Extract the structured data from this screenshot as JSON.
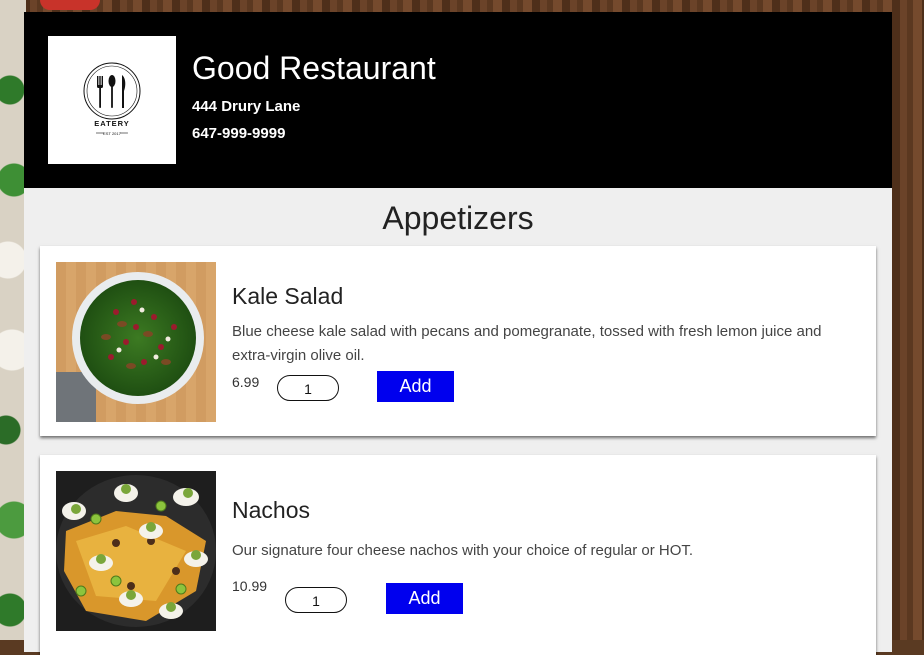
{
  "restaurant": {
    "name": "Good Restaurant",
    "address": "444 Drury Lane",
    "phone": "647-999-9999",
    "logo_text": "EATERY",
    "logo_subtext": "EST 2017"
  },
  "section": {
    "title": "Appetizers"
  },
  "items": [
    {
      "name": "Kale Salad",
      "description": "Blue cheese kale salad with pecans and pomegranate, tossed with fresh lemon juice and extra-virgin olive oil.",
      "price": "6.99",
      "quantity": "1",
      "add_label": "Add",
      "image_icon": "kale-salad-photo"
    },
    {
      "name": "Nachos",
      "description": "Our signature four cheese nachos with your choice of regular or HOT.",
      "price": "10.99",
      "quantity": "1",
      "add_label": "Add",
      "image_icon": "nachos-photo"
    }
  ],
  "colors": {
    "header_bg": "#000000",
    "add_button": "#0000ee",
    "page_bg": "#efefef"
  }
}
